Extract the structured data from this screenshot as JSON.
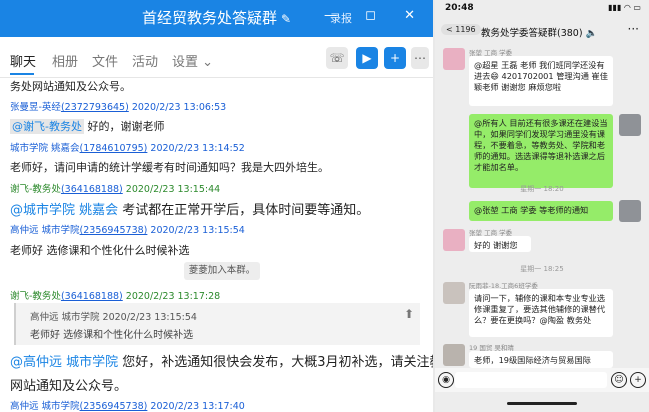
{
  "qq": {
    "title": "首经贸教务处答疑群",
    "edit_icon": "✎",
    "user_label": "录报",
    "window_controls": "— ◻ ✕",
    "tabs": [
      "聊天",
      "相册",
      "文件",
      "活动",
      "设置 ⌄"
    ],
    "toolbar_icons": [
      "phone-icon",
      "video-icon",
      "add-icon",
      "more-icon"
    ],
    "messages": {
      "m0_text": "务处网站通知及公众号。",
      "m1_name": "张曼昱-英经",
      "m1_id": "(2372793645)",
      "m1_time": "2020/2/23 13:06:53",
      "m1_mention": "@谢飞-教务处",
      "m1_text": " 好的，谢谢老师",
      "m2_name": "城市学院 姚嘉会",
      "m2_id": "(1784610795)",
      "m2_time": "2020/2/23 13:14:52",
      "m2_text": "老师好，请问申请的统计学缓考有时间通知吗？我是大四外培生。",
      "m3_name": "谢飞-教务处",
      "m3_id": "(364168188)",
      "m3_time": "2020/2/23 13:15:44",
      "m3_mention": "@城市学院 姚嘉会",
      "m3_text": " 考试都在正常开学后，具体时间要等通知。",
      "m4_name": "高仲远 城市学院",
      "m4_id": "(2356945738)",
      "m4_time": "2020/2/23 13:15:54",
      "m4_text": "老师好 选修课和个性化什么时候补选",
      "sys_text": "菱菱加入本群。",
      "m5_name": "谢飞-教务处",
      "m5_id": "(364168188)",
      "m5_time": "2020/2/23 13:17:28",
      "quote_head": "高仲远 城市学院   2020/2/23 13:15:54",
      "quote_text": "老师好 选修课和个性化什么时候补选",
      "m5_mention": "@高仲远 城市学院",
      "m5_text": " 您好，补选通知很快会发布，大概3月初补选，请关注教务处",
      "m5_text2": "网站通知及公众号。",
      "m6_name": "高仲远 城市学院",
      "m6_id": "(2356945738)",
      "m6_time": "2020/2/23 13:17:40"
    }
  },
  "wx": {
    "time": "20:48",
    "signal": "▮▮▮ ◠ ▭",
    "back_label": "< 1196",
    "title": "教务处学委答疑群(380) 🔈",
    "more": "···",
    "msgs": {
      "a_sender": "张堃 工商 学委",
      "a_text": "@超星 王磊 老师 我们班同学还没有进去😄 4201702001 管理沟通 崔佳颖老师 谢谢您 麻烦您啦",
      "b_text": "@所有人 目前还有很多课还在建设当中，如果同学们发现学习通里没有课程，不要着急，等教务处、学院和老师的通知。选选课得等退补选课之后才能加名单。",
      "stamp1": "星期一 18:20",
      "c_text": "@张堃 工商 学委 等老师的通知",
      "d_sender": "张堃 工商 学委",
      "d_text": "好的 谢谢您",
      "stamp2": "星期一 18:25",
      "e_sender": "阮雨菲-18.工商6班学委",
      "e_text": "请问一下，辅修的课和本专业专业选修课重复了，要选其他辅修的课替代么？要在更换吗？@陶盈 教务处",
      "f_sender": "19 国贸 吴和晴",
      "f_text": "老师，19级国际经济与贸易国际"
    },
    "bottom_icons": [
      "voice-icon",
      "emoji-icon",
      "plus-icon"
    ]
  },
  "colors": {
    "qq_blue": "#1a84e4",
    "wx_green": "#95ec69",
    "wx_bg": "#ededed"
  }
}
